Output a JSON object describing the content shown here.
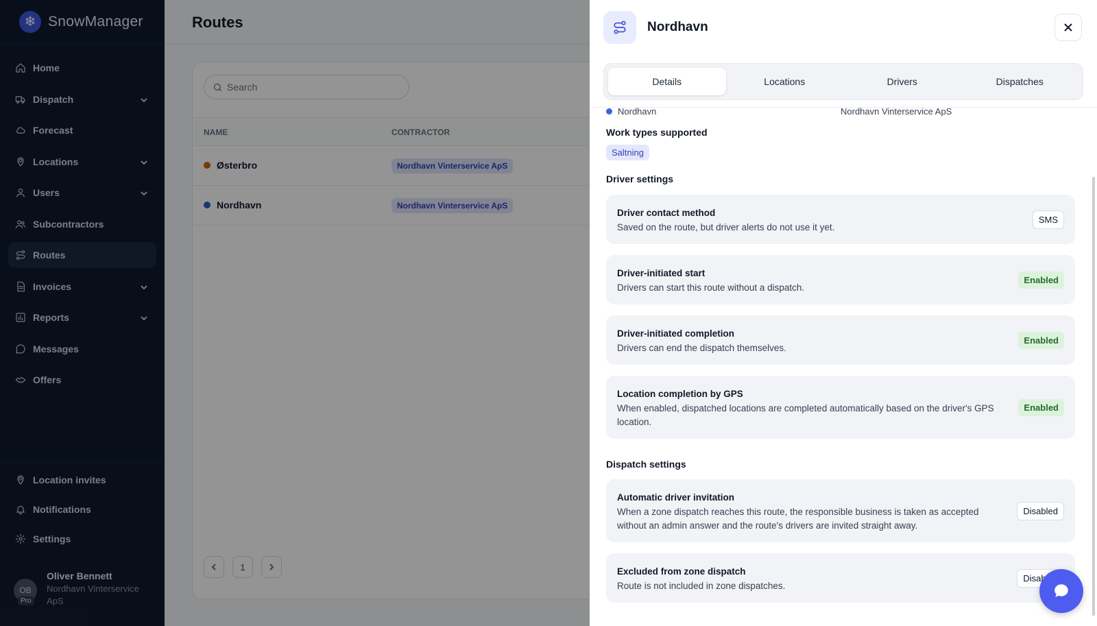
{
  "app": {
    "name": "SnowManager"
  },
  "sidebar": {
    "items": [
      {
        "label": "Home",
        "icon": "home-icon",
        "expandable": false
      },
      {
        "label": "Dispatch",
        "icon": "truck-icon",
        "expandable": true
      },
      {
        "label": "Forecast",
        "icon": "cloud-icon",
        "expandable": false
      },
      {
        "label": "Locations",
        "icon": "map-pin-icon",
        "expandable": true
      },
      {
        "label": "Users",
        "icon": "user-icon",
        "expandable": true
      },
      {
        "label": "Subcontractors",
        "icon": "users-icon",
        "expandable": false
      },
      {
        "label": "Routes",
        "icon": "route-icon",
        "expandable": false,
        "active": true
      },
      {
        "label": "Invoices",
        "icon": "file-icon",
        "expandable": true
      },
      {
        "label": "Reports",
        "icon": "bar-chart-icon",
        "expandable": true
      },
      {
        "label": "Messages",
        "icon": "message-icon",
        "expandable": false
      },
      {
        "label": "Offers",
        "icon": "handshake-icon",
        "expandable": false
      }
    ],
    "bottom_items": [
      {
        "label": "Location invites",
        "icon": "map-pin-icon"
      },
      {
        "label": "Notifications",
        "icon": "bell-icon"
      },
      {
        "label": "Settings",
        "icon": "gear-icon"
      }
    ],
    "user": {
      "initials": "OB",
      "badge": "Pro",
      "name": "Oliver Bennett",
      "org": "Nordhavn Vinterservice ApS"
    }
  },
  "main": {
    "title": "Routes",
    "search_placeholder": "Search",
    "columns": [
      "NAME",
      "CONTRACTOR"
    ],
    "rows": [
      {
        "name": "Østerbro",
        "color": "#c9650c",
        "contractor": "Nordhavn Vinterservice ApS"
      },
      {
        "name": "Nordhavn",
        "color": "#2c5bd0",
        "contractor": "Nordhavn Vinterservice ApS"
      }
    ],
    "pagination": {
      "current": "1"
    }
  },
  "panel": {
    "title": "Nordhavn",
    "tabs": [
      {
        "label": "Details",
        "active": true
      },
      {
        "label": "Locations",
        "active": false
      },
      {
        "label": "Drivers",
        "active": false
      },
      {
        "label": "Dispatches",
        "active": false
      }
    ],
    "cut_row": {
      "name": "Nordhavn",
      "contractor": "Nordhavn Vinterservice ApS"
    },
    "work_types_label": "Work types supported",
    "work_types": [
      "Saltning"
    ],
    "driver_settings_label": "Driver settings",
    "driver_settings": [
      {
        "title": "Driver contact method",
        "description": "Saved on the route, but driver alerts do not use it yet.",
        "value": "SMS",
        "style": "neutral"
      },
      {
        "title": "Driver-initiated start",
        "description": "Drivers can start this route without a dispatch.",
        "value": "Enabled",
        "style": "enabled"
      },
      {
        "title": "Driver-initiated completion",
        "description": "Drivers can end the dispatch themselves.",
        "value": "Enabled",
        "style": "enabled"
      },
      {
        "title": "Location completion by GPS",
        "description": "When enabled, dispatched locations are completed automatically based on the driver's GPS location.",
        "value": "Enabled",
        "style": "enabled"
      }
    ],
    "dispatch_settings_label": "Dispatch settings",
    "dispatch_settings": [
      {
        "title": "Automatic driver invitation",
        "description": "When a zone dispatch reaches this route, the responsible business is taken as accepted without an admin answer and the route's drivers are invited straight away.",
        "value": "Disabled",
        "style": "neutral"
      },
      {
        "title": "Excluded from zone dispatch",
        "description": "Route is not included in zone dispatches.",
        "value": "Disabled",
        "style": "neutral"
      }
    ]
  }
}
